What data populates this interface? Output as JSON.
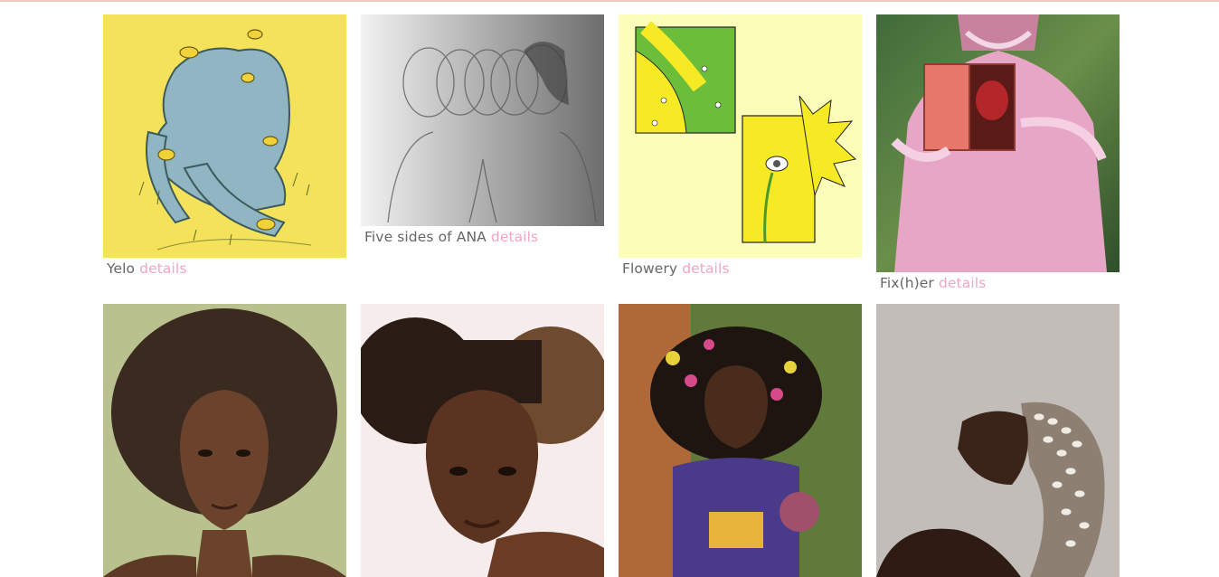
{
  "gallery": {
    "row1": [
      {
        "title": "Yelo",
        "link": "details",
        "image": "illustration-blue-figure-with-frogs"
      },
      {
        "title": "Five sides of ANA",
        "link": "details",
        "image": "pencil-drawing-multiple-faces"
      },
      {
        "title": "Flowery",
        "link": "details",
        "image": "illustration-yellow-flower-faces"
      },
      {
        "title": "Fix(h)er",
        "link": "details",
        "image": "painting-woman-pink-dress-heart-book"
      }
    ],
    "row2": [
      {
        "image": "portrait-woman-afro"
      },
      {
        "image": "portrait-woman-afro-puffs"
      },
      {
        "image": "portrait-woman-flowers-in-hair"
      },
      {
        "image": "portrait-woman-cowrie-shell-headpiece"
      }
    ]
  },
  "colors": {
    "link": "#f2a6c0",
    "caption": "#666666",
    "rule": "#ecc9c3"
  }
}
